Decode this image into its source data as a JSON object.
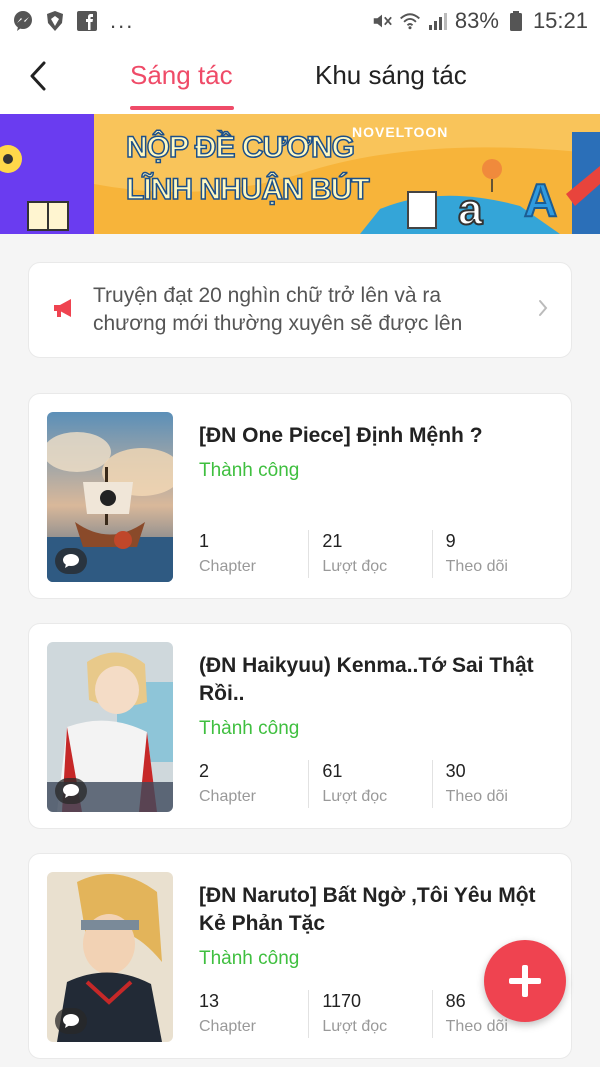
{
  "status_bar": {
    "battery": "83%",
    "time": "15:21",
    "overflow": "...",
    "left_icons": [
      "messenger-icon",
      "brave-icon",
      "facebook-icon"
    ],
    "right_icons": [
      "mute-icon",
      "wifi-icon",
      "signal-icon",
      "battery-icon"
    ]
  },
  "header": {
    "tabs": [
      {
        "label": "Sáng tác",
        "active": true
      },
      {
        "label": "Khu sáng tác",
        "active": false
      }
    ]
  },
  "banner": {
    "line1": "NỘP ĐỀ CƯƠNG",
    "line2": "LĨNH NHUẬN BÚT",
    "brand": "NOVELTOON"
  },
  "notice": {
    "text": "Truyện đạt 20 nghìn chữ trở lên và ra chương mới thường xuyên sẽ được lên"
  },
  "stories": [
    {
      "title": "[ĐN One Piece] Định Mệnh ?",
      "status": "Thành công",
      "stats": [
        {
          "value": "1",
          "label": "Chapter"
        },
        {
          "value": "21",
          "label": "Lượt đọc"
        },
        {
          "value": "9",
          "label": "Theo dõi"
        }
      ]
    },
    {
      "title": "(ĐN Haikyuu) Kenma..Tớ Sai Thật Rồi..",
      "status": "Thành công",
      "stats": [
        {
          "value": "2",
          "label": "Chapter"
        },
        {
          "value": "61",
          "label": "Lượt đọc"
        },
        {
          "value": "30",
          "label": "Theo dõi"
        }
      ]
    },
    {
      "title": "[ĐN Naruto] Bất Ngờ ,Tôi Yêu Một Kẻ Phản Tặc",
      "status": "Thành công",
      "stats": [
        {
          "value": "13",
          "label": "Chapter"
        },
        {
          "value": "1170",
          "label": "Lượt đọc"
        },
        {
          "value": "86",
          "label": "Theo dõi"
        }
      ]
    }
  ],
  "colors": {
    "accent": "#ef4b68",
    "success": "#3fbf3f",
    "fab": "#ef4350",
    "background": "#f5f5f5"
  }
}
